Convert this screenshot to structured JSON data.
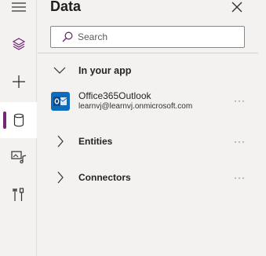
{
  "panel": {
    "title": "Data",
    "search_placeholder": "Search",
    "section": {
      "label": "In your app",
      "expanded": true
    },
    "source": {
      "name": "Office365Outlook",
      "account": "learnvj@learnvj.onmicrosoft.com"
    },
    "groups": [
      {
        "label": "Entities",
        "expanded": false
      },
      {
        "label": "Connectors",
        "expanded": false
      }
    ],
    "more_glyph": "···"
  },
  "rail": {
    "items": [
      {
        "icon": "hamburger-icon",
        "active": false
      },
      {
        "icon": "layers-icon",
        "active": false
      },
      {
        "icon": "plus-icon",
        "active": false
      },
      {
        "icon": "database-icon",
        "active": true
      },
      {
        "icon": "media-icon",
        "active": false
      },
      {
        "icon": "tools-icon",
        "active": false
      }
    ]
  },
  "colors": {
    "accent": "#742774",
    "outlook": "#0f6cbd",
    "background": "#f3f2f1"
  }
}
